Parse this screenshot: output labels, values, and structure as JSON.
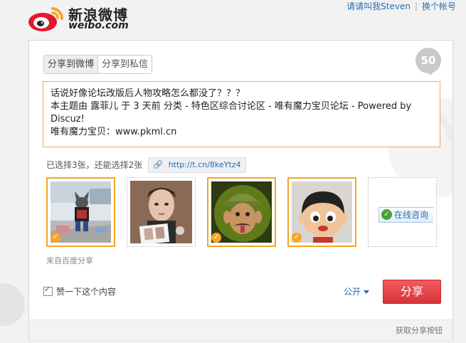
{
  "brand": {
    "name_cn": "新浪微博",
    "name_en": "weibo.com"
  },
  "top_links": {
    "user": "请请叫我Steven",
    "switch": "换个帐号"
  },
  "tabs": [
    {
      "label": "分享到微博",
      "active": true
    },
    {
      "label": "分享到私信",
      "active": false
    }
  ],
  "remaining_chars": "50",
  "post_text": [
    "话说好像论坛改版后人物攻略怎么都没了？？？",
    "本主题由 露菲儿 于 3 天前 分类 - 特色区综合讨论区 - 唯有魔力宝贝论坛 - Powered by",
    "Discuz!",
    "唯有魔力宝贝：www.pkml.cn"
  ],
  "selection_status": "已选择3张，还能选择2张",
  "short_url": "http://t.cn/8keYtz4",
  "images": [
    {
      "name": "dog-costume-photo",
      "selected": true
    },
    {
      "name": "man-photo",
      "selected": false
    },
    {
      "name": "cartoon-soldier",
      "selected": true
    },
    {
      "name": "cartoon-boy",
      "selected": true
    },
    {
      "name": "online-chat-banner",
      "selected": false,
      "button_label": "在线咨询"
    }
  ],
  "source_label": "来自百度分享",
  "like_label": "赞一下这个内容",
  "visibility_label": "公开",
  "share_button": "分享",
  "footer_link": "获取分享按钮",
  "colors": {
    "accent_orange": "#f6a622",
    "share_red": "#e0393e",
    "link_blue": "#2b6dad"
  }
}
